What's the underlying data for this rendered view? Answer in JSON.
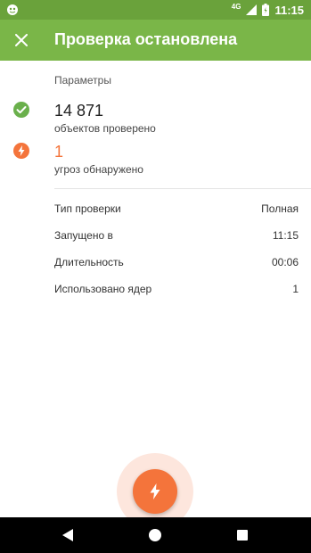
{
  "status_bar": {
    "time": "11:15",
    "network_label": "4G",
    "icons": [
      "app-notification-icon",
      "signal-icon",
      "battery-icon"
    ]
  },
  "toolbar": {
    "title": "Проверка остановлена",
    "close_icon": "close-icon"
  },
  "summary": {
    "section_label": "Параметры",
    "scanned": {
      "value": "14 871",
      "caption": "объектов проверено",
      "icon": "check-circle-icon"
    },
    "threats": {
      "value": "1",
      "caption": "угроз обнаружено",
      "icon": "threat-bolt-icon"
    }
  },
  "details": [
    {
      "label": "Тип проверки",
      "value": "Полная"
    },
    {
      "label": "Запущено в",
      "value": "11:15"
    },
    {
      "label": "Длительность",
      "value": "00:06"
    },
    {
      "label": "Использовано ядер",
      "value": "1"
    }
  ],
  "fab": {
    "icon": "bolt-icon"
  },
  "nav": {
    "icons": [
      "back-icon",
      "home-icon",
      "recents-icon"
    ]
  },
  "colors": {
    "status_bar": "#6aa23b",
    "toolbar": "#7ab648",
    "accent_green": "#6ab04c",
    "threat_orange": "#f4743b"
  }
}
